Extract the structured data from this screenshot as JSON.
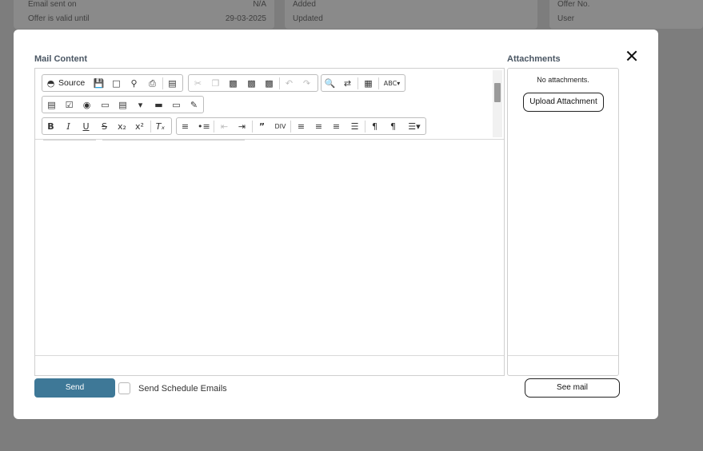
{
  "background": {
    "card1": {
      "rows": [
        {
          "label": "Email sent on",
          "value": "N/A"
        },
        {
          "label": "Offer is valid until",
          "value": "29-03-2025"
        }
      ]
    },
    "card2": {
      "rows": [
        {
          "label": "Added"
        },
        {
          "label": "Updated"
        }
      ]
    },
    "card3": {
      "rows": [
        {
          "label": "Offer No."
        },
        {
          "label": "User"
        }
      ]
    }
  },
  "modal": {
    "mail_content_title": "Mail Content",
    "attachments_title": "Attachments",
    "toolbar": {
      "source_label": "Source",
      "row1": [
        "source-icon",
        "save-icon",
        "new-page-icon",
        "preview-icon",
        "print-icon",
        "templates-icon",
        "cut-icon",
        "copy-icon",
        "paste-icon",
        "paste-text-icon",
        "paste-word-icon",
        "undo-icon",
        "redo-icon",
        "find-icon",
        "replace-icon",
        "select-all-icon",
        "spellcheck-icon"
      ],
      "row2": [
        "form-icon",
        "checkbox-icon",
        "radio-icon",
        "textfield-icon",
        "textarea-icon",
        "select-icon",
        "button-icon",
        "image-button-icon",
        "hidden-field-icon"
      ],
      "row3": [
        "bold-icon",
        "italic-icon",
        "underline-icon",
        "strikethrough-icon",
        "subscript-icon",
        "superscript-icon",
        "remove-format-icon",
        "numbered-list-icon",
        "bulleted-list-icon",
        "outdent-icon",
        "indent-icon",
        "blockquote-icon",
        "div-icon",
        "align-left-icon",
        "align-center-icon",
        "align-right-icon",
        "justify-icon",
        "ltr-icon",
        "rtl-icon",
        "language-icon"
      ]
    },
    "attachments": {
      "empty_text": "No attachments.",
      "upload_label": "Upload Attachment"
    },
    "footer": {
      "send_label": "Send",
      "schedule_label": "Send Schedule Emails",
      "schedule_checked": false,
      "see_mail_label": "See mail"
    },
    "colors": {
      "send_button": "#3e7897",
      "overlay": "#7d7d7d"
    }
  }
}
